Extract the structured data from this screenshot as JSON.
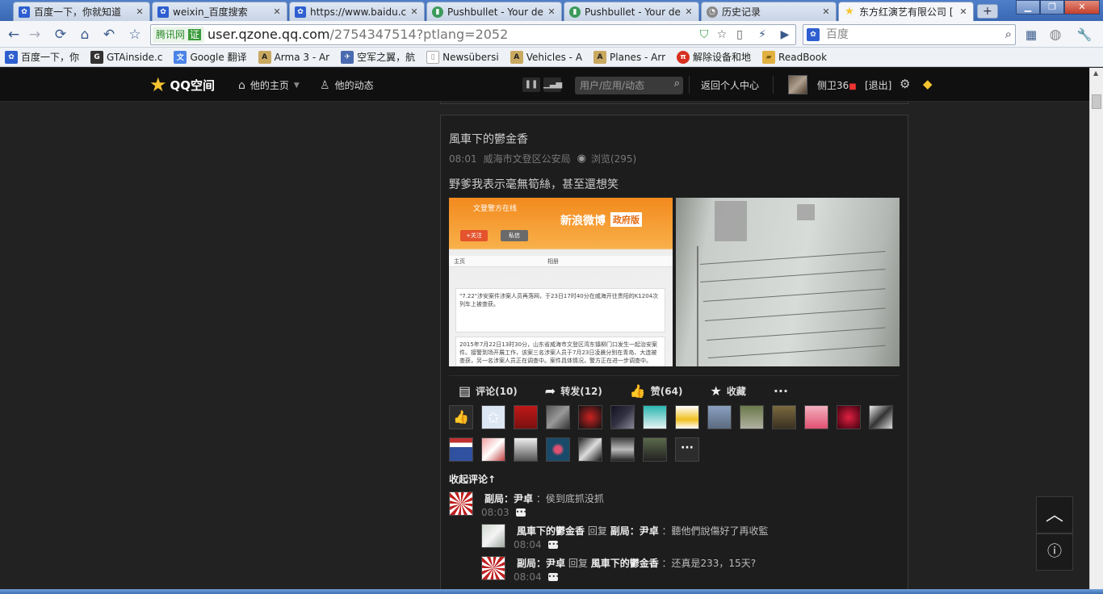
{
  "browser": {
    "tabs": [
      {
        "title": "百度一下，你就知道",
        "favicon": "baidu-paw-icon"
      },
      {
        "title": "weixin_百度搜索",
        "favicon": "baidu-paw-icon"
      },
      {
        "title": "https://www.baidu.c",
        "favicon": "baidu-paw-icon"
      },
      {
        "title": "Pushbullet - Your de",
        "favicon": "pushbullet-icon"
      },
      {
        "title": "Pushbullet - Your de",
        "favicon": "pushbullet-icon"
      },
      {
        "title": "历史记录",
        "favicon": "history-icon"
      },
      {
        "title": "东方红演艺有限公司 [",
        "favicon": "star-icon"
      }
    ],
    "address": {
      "security_label": "腾讯网",
      "verified_badge": "证",
      "url_host": "user.qzone.qq.com",
      "url_path": "/2754347514?ptlang=2052"
    },
    "search": {
      "placeholder": "百度"
    },
    "bookmarks": [
      {
        "label": "百度一下，你",
        "icon": "baidu-paw-icon",
        "color": "#2e5fd0"
      },
      {
        "label": "GTAinside.c",
        "icon": "gtainside-icon",
        "color": "#333333"
      },
      {
        "label": "Google 翻译",
        "icon": "translate-icon",
        "color": "#4a84e8"
      },
      {
        "label": "Arma 3 - Ar",
        "icon": "armaholic-icon",
        "color": "#7a5a20"
      },
      {
        "label": "空军之翼，航",
        "icon": "wing-icon",
        "color": "#4a6ab0"
      },
      {
        "label": "Newsübersi",
        "icon": "page-icon",
        "color": "#cccccc"
      },
      {
        "label": "Vehicles - A",
        "icon": "armaholic-icon",
        "color": "#7a5a20"
      },
      {
        "label": "Planes - Arr",
        "icon": "armaholic-icon",
        "color": "#7a5a20"
      },
      {
        "label": "解除设备和地",
        "icon": "pi-icon",
        "color": "#d83020"
      },
      {
        "label": "ReadBook",
        "icon": "folder-icon",
        "color": "#e0b040"
      }
    ]
  },
  "qzone": {
    "logo": "QQ空间",
    "nav_home": "他的主页",
    "nav_feed": "他的动态",
    "search_placeholder": "用户/应用/动态",
    "back_link": "返回个人中心",
    "user_name": "侧卫36",
    "logout": "[退出]"
  },
  "post": {
    "author": "風車下的鬱金香",
    "time": "08:01",
    "location": "威海市文登区公安局",
    "views": "浏览(295)",
    "text": "野爹我表示毫無筍絲，甚至還想笑",
    "photo1": {
      "account": "文登警方在线",
      "banner": "新浪微博",
      "gov": "政府版",
      "follow": "+关注",
      "message": "私信",
      "tab_home": "主页",
      "tab_album": "相册",
      "post1": "\"7.22\"涉安案件涉案人员再落网，于23日17时40分在威海开往贵阳的K1204次列车上被查获。",
      "post2": "2015年7月22日13时30分，山东省威海市文登区湾东镇柳门口发生一起治安案件。接警到场开展工作，该案三名涉案人员于7月23日凌晨分别在青岛、大连被查获，另一名涉案人员正在调查中。案件具体情况，警方正在进一步调查中。"
    },
    "actions": {
      "comment": "评论(10)",
      "forward": "转发(12)",
      "like": "赞(64)",
      "favorite": "收藏",
      "more": "···"
    },
    "collapse_label": "收起评论↑",
    "comments": [
      {
        "author": "副局：尹卓",
        "reply_word": "",
        "target": "",
        "text": "：侯到底抓没抓",
        "time": "08:03"
      },
      {
        "author": "風車下的鬱金香",
        "reply_word": "回复",
        "target": "副局：尹卓",
        "text": "：聽他們說傷好了再收監",
        "time": "08:04"
      },
      {
        "author": "副局：尹卓",
        "reply_word": "回复",
        "target": "風車下的鬱金香",
        "text": "：还真是233，15天?",
        "time": "08:04"
      }
    ]
  },
  "colors": {
    "accent": "#f5c430",
    "card_bg": "#1d1d1d",
    "page_bg": "#222222"
  }
}
